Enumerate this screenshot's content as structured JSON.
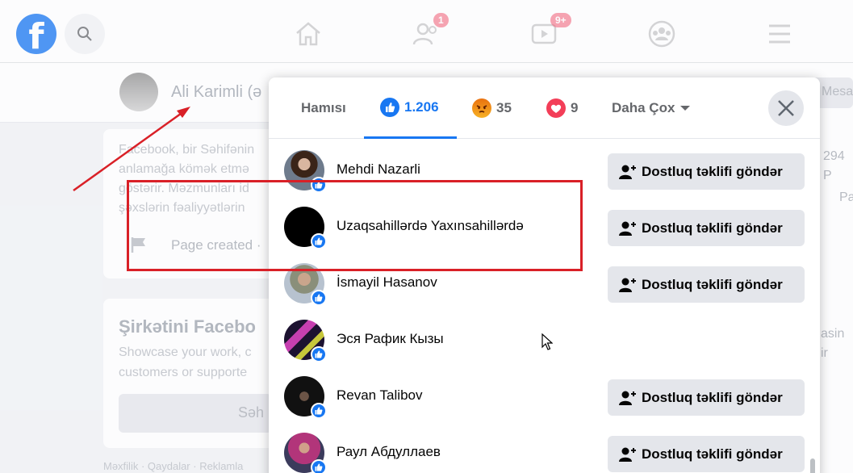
{
  "topbar": {
    "logo_letter": "f",
    "friends_badge": "1",
    "watch_badge": "9+"
  },
  "background": {
    "profile_name": "Ali Karimli (ə",
    "about_text_1": "Facebook, bir Səhifənin",
    "about_text_2": "anlamağa kömək etmə",
    "about_text_3": "göstərir. Məzmunları id",
    "about_text_4": "şəxslərin fəaliyyətlərin",
    "page_created": "Page created ·",
    "promo_title": "Şirkətini Facebo",
    "promo_text_1": "Showcase your work, c",
    "promo_text_2": "customers or supporte",
    "promo_btn": "Səh",
    "footer": "Məxfilik · Qaydalar · Reklamla",
    "mesaj": "Mesa",
    "right_1": "294 P",
    "right_2": "Pa",
    "right_3": "asin ir"
  },
  "dialog": {
    "tabs": [
      {
        "label": "Hamısı"
      },
      {
        "label": "1.206",
        "icon": "like-icon"
      },
      {
        "label": "35",
        "icon": "angry-icon"
      },
      {
        "label": "9",
        "icon": "love-icon"
      },
      {
        "label": "Daha Çox",
        "icon": "chevron-down-icon"
      }
    ],
    "add_friend_label": "Dostluq təklifi göndər",
    "people": [
      {
        "name": "Mehdi Nazarli",
        "has_button": true
      },
      {
        "name": "Uzaqsahillərdə Yaxınsahillərdə",
        "has_button": true
      },
      {
        "name": "İsmayil Hasanov",
        "has_button": true
      },
      {
        "name": "Эся Рафик Кызы",
        "has_button": false
      },
      {
        "name": "Revan Talibov",
        "has_button": true
      },
      {
        "name": "Раул Абдуллаев",
        "has_button": true
      }
    ]
  },
  "colors": {
    "brand": "#1877f2",
    "badge": "#f02849",
    "annotation": "#d92027"
  }
}
